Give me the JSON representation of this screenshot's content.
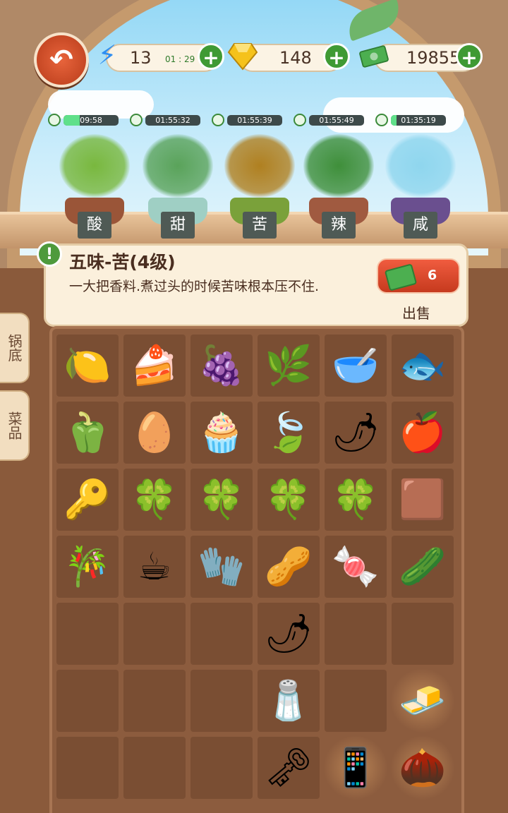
{
  "topbar": {
    "energy": {
      "value": "13",
      "timer": "01 : 29"
    },
    "gems": {
      "value": "148"
    },
    "cash": {
      "value": "19855"
    }
  },
  "plants": [
    {
      "timer": "09:58",
      "fill": 0.3,
      "label": "酸",
      "foliage": "#79b83e",
      "pot": "#9a5538"
    },
    {
      "timer": "01:55:32",
      "fill": 0,
      "label": "甜",
      "foliage": "#5aa35a",
      "pot": "#9fcfc4"
    },
    {
      "timer": "01:55:39",
      "fill": 0,
      "label": "苦",
      "foliage": "#b08020",
      "pot": "#7aa13a"
    },
    {
      "timer": "01:55:49",
      "fill": 0,
      "label": "辣",
      "foliage": "#3f8f3a",
      "pot": "#a05a40"
    },
    {
      "timer": "01:35:19",
      "fill": 0.1,
      "label": "咸",
      "foliage": "#8fd6ee",
      "pot": "#6a4f8f"
    }
  ],
  "info": {
    "title": "五味-苦(4级)",
    "description": "一大把香料.煮过头的时候苦味根本压不住.",
    "sell_count": "6",
    "sell_label": "出售"
  },
  "tabs": [
    {
      "label": "锅底"
    },
    {
      "label": "菜品"
    }
  ],
  "grid": [
    [
      "lime",
      "cake",
      "raspberry",
      "tamarind",
      "chili-powder",
      "dried-fish"
    ],
    [
      "bell-pepper",
      "salted-egg",
      "cream-puff",
      "tea-leaves",
      "red-peppers",
      "hawthorn"
    ],
    [
      "car-key",
      "clover",
      "clover",
      "clover",
      "clover",
      "brown-sugar"
    ],
    [
      "sugarcane",
      "coffee-beans",
      "glove",
      "spices",
      "candy",
      "bitter-melon"
    ],
    [
      "",
      "",
      "",
      "green-peppers",
      "",
      ""
    ],
    [
      "",
      "",
      "",
      "salt",
      "",
      "butter"
    ],
    [
      "",
      "",
      "",
      "key",
      "phone",
      "walnut"
    ]
  ]
}
